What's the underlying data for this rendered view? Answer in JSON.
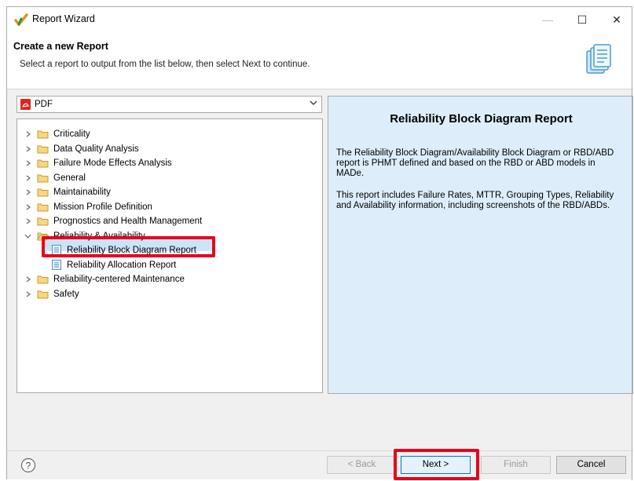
{
  "window": {
    "title": "Report Wizard",
    "controls": {
      "minimize": "—",
      "maximize": "☐",
      "close": "✕"
    }
  },
  "header": {
    "title": "Create a new Report",
    "description": "Select a report to output from the list below, then select Next to continue."
  },
  "format": {
    "selected": "PDF",
    "icon": "pdf-icon"
  },
  "tree": {
    "folders": [
      {
        "label": "Criticality",
        "expanded": false
      },
      {
        "label": "Data Quality Analysis",
        "expanded": false
      },
      {
        "label": "Failure Mode Effects Analysis",
        "expanded": false
      },
      {
        "label": "General",
        "expanded": false
      },
      {
        "label": "Maintainability",
        "expanded": false
      },
      {
        "label": "Mission Profile Definition",
        "expanded": false
      },
      {
        "label": "Prognostics and Health Management",
        "expanded": false
      },
      {
        "label": "Reliability & Availability",
        "expanded": true,
        "children": [
          {
            "label": "Reliability Block Diagram Report",
            "selected": true
          },
          {
            "label": "Reliability Allocation Report",
            "selected": false
          }
        ]
      },
      {
        "label": "Reliability-centered Maintenance",
        "expanded": false
      },
      {
        "label": "Safety",
        "expanded": false
      }
    ]
  },
  "description_panel": {
    "title": "Reliability Block Diagram Report",
    "paragraph1": "The Reliability Block Diagram/Availability Block Diagram or RBD/ABD report is PHMT defined and based on the RBD or ABD models in MADe.",
    "paragraph2": "This report includes Failure Rates, MTTR, Grouping Types, Reliability and Availability information, including screenshots of the RBD/ABDs."
  },
  "buttons": {
    "help": "?",
    "back": "< Back",
    "next": "Next >",
    "finish": "Finish",
    "cancel": "Cancel"
  },
  "colors": {
    "highlight": "#e8001c",
    "selection": "#cce4f7",
    "panel": "#ddeefa",
    "folder": "#e8c25a"
  }
}
